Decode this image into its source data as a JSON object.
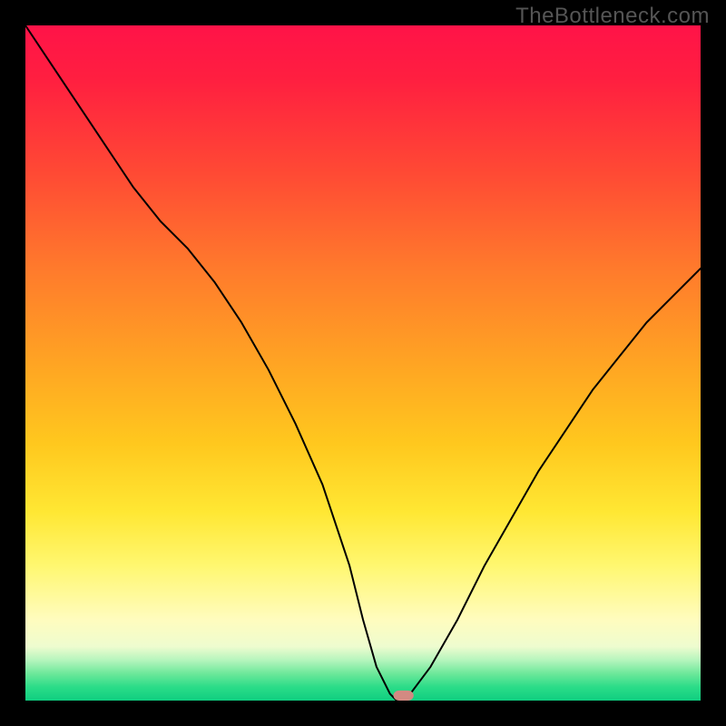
{
  "watermark": "TheBottleneck.com",
  "colors": {
    "frame": "#000000",
    "curve": "#000000",
    "marker": "#d38a82",
    "gradient_stops": [
      "#ff1348",
      "#ff1f40",
      "#ff4a34",
      "#ff7a2c",
      "#ffa423",
      "#ffc81e",
      "#ffe733",
      "#fff770",
      "#fffcbe",
      "#eefccf",
      "#b6f5bd",
      "#6de89a",
      "#2bdc88",
      "#0fce80"
    ]
  },
  "chart_data": {
    "type": "line",
    "title": "",
    "xlabel": "",
    "ylabel": "",
    "xlim": [
      0,
      100
    ],
    "ylim": [
      0,
      100
    ],
    "annotations": [],
    "series": [
      {
        "name": "bottleneck-curve",
        "x": [
          0,
          4,
          8,
          12,
          16,
          20,
          24,
          28,
          32,
          36,
          40,
          44,
          48,
          50,
          52,
          54,
          55,
          56,
          57,
          60,
          64,
          68,
          72,
          76,
          80,
          84,
          88,
          92,
          96,
          100
        ],
        "y": [
          100,
          94,
          88,
          82,
          76,
          71,
          67,
          62,
          56,
          49,
          41,
          32,
          20,
          12,
          5,
          1,
          0,
          0,
          1,
          5,
          12,
          20,
          27,
          34,
          40,
          46,
          51,
          56,
          60,
          64
        ]
      }
    ],
    "marker": {
      "x": 56,
      "y": 0,
      "width": 3,
      "height": 1.5
    }
  }
}
